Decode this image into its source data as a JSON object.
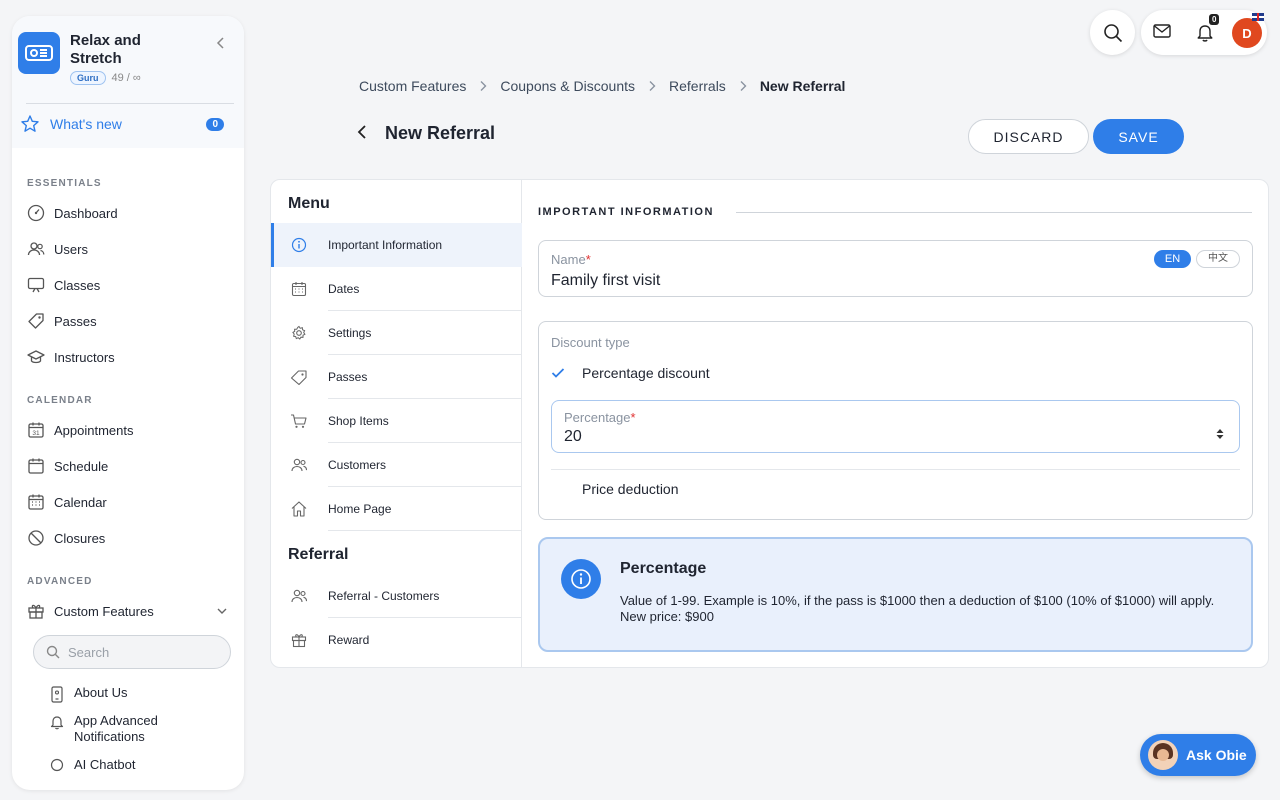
{
  "sidebar": {
    "brand_name": "Relax and Stretch",
    "brand_badge": "Guru",
    "brand_count": "49 / ∞",
    "whats_new": {
      "label": "What's new",
      "count": "0"
    },
    "sections": {
      "essentials": "ESSENTIALS",
      "calendar": "CALENDAR",
      "advanced": "ADVANCED"
    },
    "essentials": [
      {
        "label": "Dashboard",
        "icon": "gauge-icon"
      },
      {
        "label": "Users",
        "icon": "users-icon"
      },
      {
        "label": "Classes",
        "icon": "board-icon"
      },
      {
        "label": "Passes",
        "icon": "tag-icon"
      },
      {
        "label": "Instructors",
        "icon": "graduation-cap-icon"
      }
    ],
    "calendar": [
      {
        "label": "Appointments",
        "icon": "calendar-31-icon"
      },
      {
        "label": "Schedule",
        "icon": "calendar-icon"
      },
      {
        "label": "Calendar",
        "icon": "calendar-grid-icon"
      },
      {
        "label": "Closures",
        "icon": "ban-icon"
      }
    ],
    "advanced": [
      {
        "label": "Custom Features",
        "icon": "gift-icon"
      }
    ],
    "search_placeholder": "Search",
    "sub_items": [
      {
        "label": "About Us",
        "icon": "phone-icon"
      },
      {
        "label": "App Advanced Notifications",
        "icon": "bell-icon"
      },
      {
        "label": "AI Chatbot",
        "icon": "chat-icon"
      }
    ]
  },
  "topbar": {
    "notifications_count": "0",
    "avatar_initial": "D"
  },
  "breadcrumb": {
    "items": [
      "Custom Features",
      "Coupons & Discounts",
      "Referrals"
    ],
    "current": "New Referral"
  },
  "page": {
    "title": "New Referral",
    "discard_label": "DISCARD",
    "save_label": "SAVE"
  },
  "menu": {
    "heading": "Menu",
    "items": [
      {
        "label": "Important Information",
        "icon": "info-icon",
        "active": true
      },
      {
        "label": "Dates",
        "icon": "calendar-icon"
      },
      {
        "label": "Settings",
        "icon": "gear-icon"
      },
      {
        "label": "Passes",
        "icon": "tag-icon"
      },
      {
        "label": "Shop Items",
        "icon": "cart-icon"
      },
      {
        "label": "Customers",
        "icon": "users-icon"
      },
      {
        "label": "Home Page",
        "icon": "home-icon"
      }
    ],
    "referral_heading": "Referral",
    "referral_items": [
      {
        "label": "Referral - Customers",
        "icon": "users-icon"
      },
      {
        "label": "Reward",
        "icon": "gift-icon"
      }
    ]
  },
  "form": {
    "section_title": "IMPORTANT INFORMATION",
    "name_label": "Name",
    "name_value": "Family first visit",
    "lang_en": "EN",
    "lang_zh": "中文",
    "discount_type_label": "Discount type",
    "option_percentage": "Percentage discount",
    "percentage_label": "Percentage",
    "percentage_value": "20",
    "option_price": "Price deduction",
    "required_mark": "*"
  },
  "info": {
    "title": "Percentage",
    "text": "Value of 1-99. Example is 10%, if the pass is $1000 then a deduction of $100 (10% of $1000) will apply. New price: $900"
  },
  "assistant": {
    "label": "Ask Obie"
  },
  "colors": {
    "accent": "#2f7ee8",
    "info_bg": "#e9f0fc",
    "avatar": "#e0481f"
  }
}
